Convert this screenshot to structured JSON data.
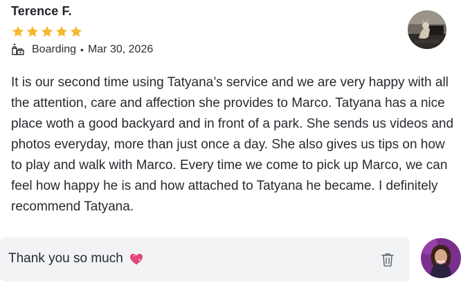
{
  "review": {
    "reviewer_name": "Terence F.",
    "rating": 5,
    "rating_max": 5,
    "star_color": "#f5b82e",
    "service": "Boarding",
    "separator": "•",
    "date": "Mar 30, 2026",
    "text": "It is our second time using Tatyana’s service and we are very happy with all the attention, care and affection she provides to Marco. Tatyana has a nice place woth a good backyard and in front of a park. She sends us videos and photos everyday, more than just once a day. She also gives us tips on how to play and walk with Marco. Every time we come to pick up Marco, we can feel how happy he is and how attached to Tatyana he became. I definitely recommend Tatyana.",
    "service_icon": "boarding-icon",
    "avatar_icon": "reviewer-avatar"
  },
  "reply": {
    "text": "Thank you so much",
    "emoji_icon": "sparkling-heart-icon",
    "delete_icon": "trash-icon",
    "avatar_icon": "owner-avatar"
  }
}
